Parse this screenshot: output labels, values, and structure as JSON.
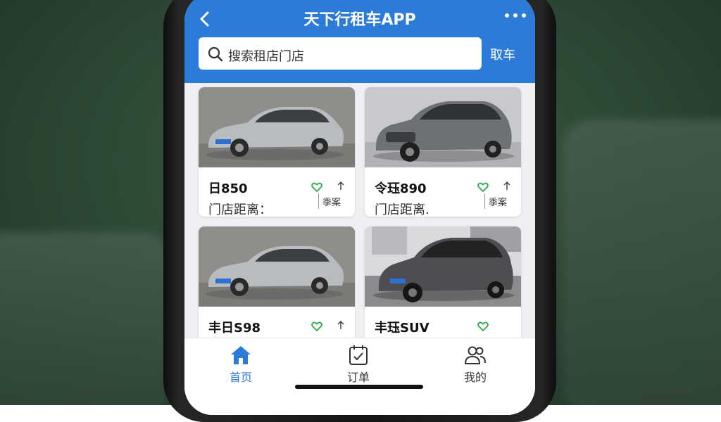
{
  "header": {
    "title": "天下行租车APP",
    "search_placeholder": "搜索租店门店",
    "action_label": "取车"
  },
  "cars": [
    {
      "name": "日850",
      "subtitle": "门店距离：",
      "tag": "季案"
    },
    {
      "name": "令珏890",
      "subtitle": "门店距离.",
      "tag": "季案"
    },
    {
      "name": "丰日S98",
      "subtitle": "",
      "tag": ""
    },
    {
      "name": "丰珏SUV",
      "subtitle": "",
      "tag": ""
    }
  ],
  "tabs": [
    {
      "label": "首页",
      "icon": "home-icon",
      "active": true
    },
    {
      "label": "订单",
      "icon": "calendar-check-icon",
      "active": false
    },
    {
      "label": "我的",
      "icon": "users-icon",
      "active": false
    }
  ],
  "colors": {
    "primary": "#2d7bd8",
    "tab_active": "#2d7bd8",
    "tab_inactive": "#333333",
    "favorite": "#2aa84a"
  }
}
